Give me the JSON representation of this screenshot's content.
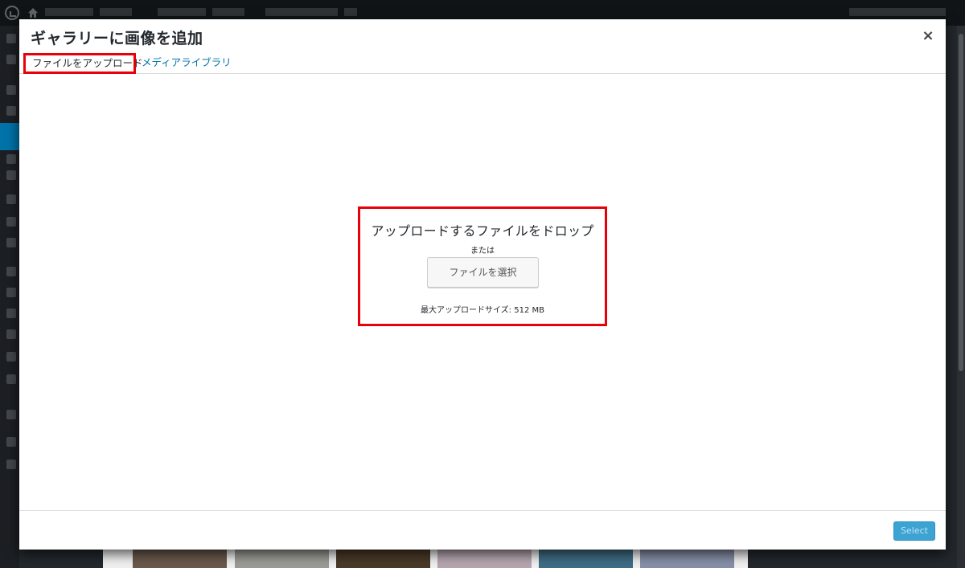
{
  "modal": {
    "title": "ギャラリーに画像を追加",
    "close_symbol": "×"
  },
  "tabs": [
    {
      "label": "ファイルをアップロード",
      "active": true
    },
    {
      "label": "メディアライブラリ",
      "active": false
    }
  ],
  "uploader": {
    "instructions": "アップロードするファイルをドロップ",
    "or": "または",
    "select_button": "ファイルを選択",
    "max_size": "最大アップロードサイズ: 512 MB"
  },
  "toolbar": {
    "select_label": "Select"
  },
  "colors": {
    "highlight": "#e8000b",
    "link": "#0073aa",
    "primary_button": "#3ca3d3"
  }
}
